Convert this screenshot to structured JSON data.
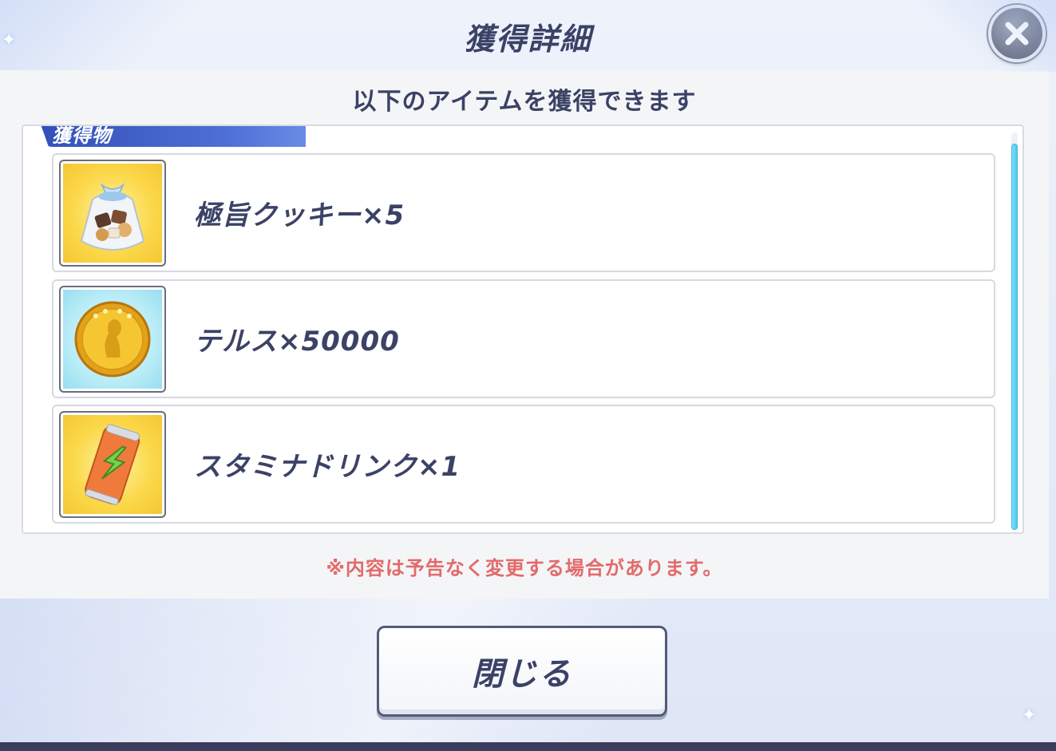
{
  "dialog": {
    "title": "獲得詳細",
    "subtitle": "以下のアイテムを獲得できます",
    "section_label": "獲得物",
    "items": [
      {
        "label": "極旨クッキー×5",
        "icon": "cookie-bag-icon"
      },
      {
        "label": "テルス×50000",
        "icon": "gold-coin-icon"
      },
      {
        "label": "スタミナドリンク×1",
        "icon": "energy-drink-icon"
      }
    ],
    "notice": "※内容は予告なく変更する場合があります。",
    "close_button": "閉じる",
    "close_icon": "close-icon"
  },
  "colors": {
    "title_text": "#3b4266",
    "accent_blue": "#3350b8",
    "notice_red": "#e36a6a",
    "scrollbar": "#4ec8ec"
  }
}
